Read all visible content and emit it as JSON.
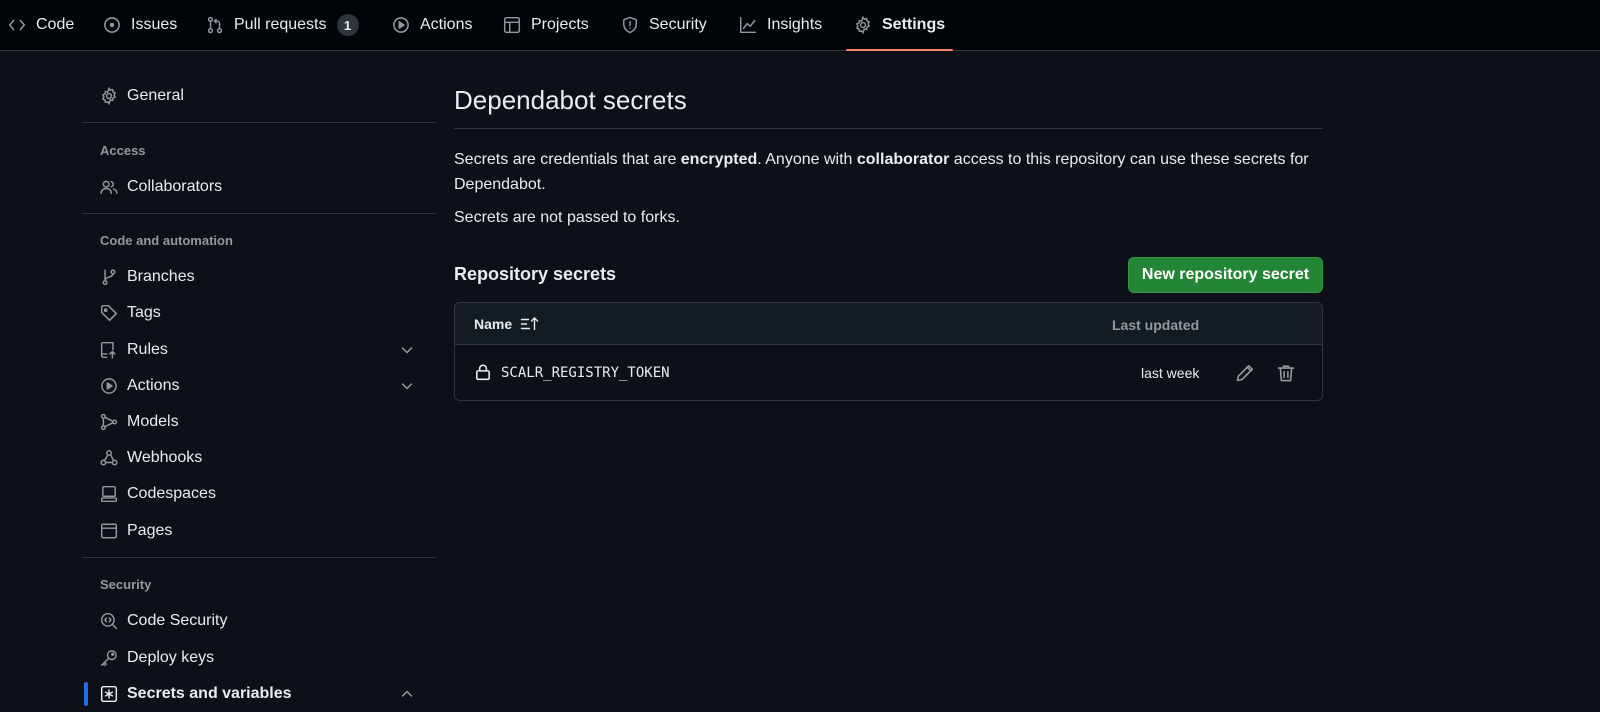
{
  "topnav": {
    "tabs": [
      {
        "label": "Code",
        "icon": "code-icon"
      },
      {
        "label": "Issues",
        "icon": "issue-opened-icon"
      },
      {
        "label": "Pull requests",
        "icon": "git-pull-request-icon",
        "counter": "1"
      },
      {
        "label": "Actions",
        "icon": "play-icon"
      },
      {
        "label": "Projects",
        "icon": "table-icon"
      },
      {
        "label": "Security",
        "icon": "shield-icon"
      },
      {
        "label": "Insights",
        "icon": "graph-icon"
      },
      {
        "label": "Settings",
        "icon": "gear-icon",
        "selected": true
      }
    ]
  },
  "sidebar": {
    "general": "General",
    "access_heading": "Access",
    "collaborators": "Collaborators",
    "code_automation_heading": "Code and automation",
    "branches": "Branches",
    "tags": "Tags",
    "rules": "Rules",
    "actions": "Actions",
    "models": "Models",
    "webhooks": "Webhooks",
    "codespaces": "Codespaces",
    "pages": "Pages",
    "security_heading": "Security",
    "code_security": "Code Security",
    "deploy_keys": "Deploy keys",
    "secrets_and_variables": "Secrets and variables"
  },
  "main": {
    "title": "Dependabot secrets",
    "intro": {
      "part1": "Secrets are credentials that are ",
      "bold1": "encrypted",
      "part2": ". Anyone with ",
      "bold2": "collaborator",
      "part3": " access to this repository can use these secrets for Dependabot."
    },
    "forks_note": "Secrets are not passed to forks.",
    "section_title": "Repository secrets",
    "new_secret_button": "New repository secret",
    "table": {
      "col_name": "Name",
      "col_updated": "Last updated",
      "rows": [
        {
          "name": "SCALR_REGISTRY_TOKEN",
          "updated": "last week"
        }
      ]
    }
  },
  "colors": {
    "background": "#0d1117",
    "nav_background": "#010409",
    "border": "#30363d",
    "primary_button": "#238636",
    "selected_tab_underline": "#f78166",
    "muted_text": "#9198a1"
  }
}
